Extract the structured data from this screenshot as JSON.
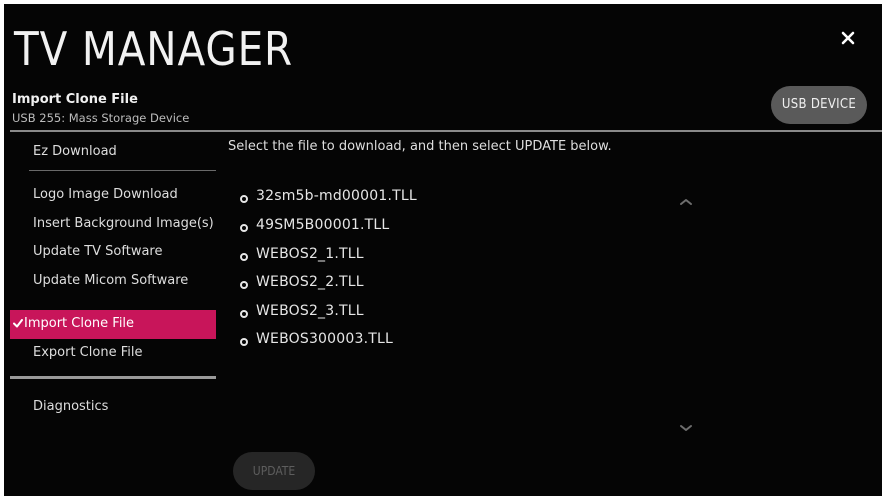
{
  "header": {
    "title": "TV MANAGER",
    "subtitle": "Import Clone File",
    "device": "USB 255: Mass Storage Device",
    "usb_button": "USB DEVICE",
    "close_icon": "close-icon"
  },
  "sidebar": {
    "items": [
      {
        "label": "Ez Download"
      },
      {
        "label": "Logo Image Download"
      },
      {
        "label": "Insert Background Image(s)"
      },
      {
        "label": "Update TV Software"
      },
      {
        "label": "Update Micom Software"
      },
      {
        "label": "Import Clone File",
        "active": true
      },
      {
        "label": "Export Clone File"
      },
      {
        "label": "Diagnostics"
      }
    ],
    "active_color": "#c8155a"
  },
  "main": {
    "instruction": "Select the file to download, and then select UPDATE below.",
    "files": [
      "32sm5b-md00001.TLL",
      "49SM5B00001.TLL",
      "WEBOS2_1.TLL",
      "WEBOS2_2.TLL",
      "WEBOS2_3.TLL",
      "WEBOS300003.TLL"
    ],
    "update_button": "UPDATE"
  }
}
